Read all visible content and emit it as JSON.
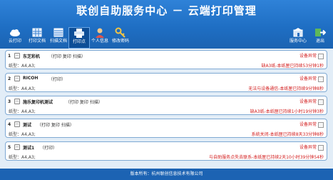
{
  "header": {
    "title": "联创自助服务中心 － 云端打印管理"
  },
  "toolbar": {
    "left": [
      {
        "label": "云打印"
      },
      {
        "label": "打印文档"
      },
      {
        "label": "扫描文档"
      },
      {
        "label": "打印点"
      },
      {
        "label": "个人信息"
      },
      {
        "label": "修改密码"
      }
    ],
    "right": [
      {
        "label": "服务中心"
      },
      {
        "label": "退出"
      }
    ]
  },
  "jobs": [
    {
      "num": "1",
      "expand": "－",
      "name": "东芝彩机",
      "caps": "（打印 复印 扫描）",
      "status": "设备异常",
      "model_label": "纸型：",
      "model": "A4,A3;",
      "message": "缺A3纸-本纸匣已持续53分钟1秒"
    },
    {
      "num": "2",
      "expand": "－",
      "name": "RICOH",
      "caps": "（打印）",
      "status": "设备异常",
      "model_label": "纸型：",
      "model": "A4,A3;",
      "message": "无法与设备通信-本纸匣已持续9分钟8秒"
    },
    {
      "num": "3",
      "expand": "－",
      "name": "施乐复印机测试",
      "caps": "（打印 复印 扫描）",
      "status": "设备异常",
      "model_label": "纸型：",
      "model": "A4,A3;",
      "message": "缺A3纸-本纸匣已持续1小时19分钟3秒"
    },
    {
      "num": "4",
      "expand": "－",
      "name": "测试",
      "caps": "（打印 复印 扫描）",
      "status": "设备异常",
      "model_label": "纸型：",
      "model": "A4,A3;",
      "message": "系统关闭-本纸匣已持续8天33分钟8秒"
    },
    {
      "num": "5",
      "expand": "－",
      "name": "测试1",
      "caps": "（打印）",
      "status": "设备异常",
      "model_label": "纸型：",
      "model": "A4,A3;",
      "message": "与自助服务点失去联系-本纸匣已持续2天10小时39分钟54秒"
    }
  ],
  "footer": {
    "text": "版本所有：杭州联创信息技术有限公司"
  },
  "colors": {
    "header": "#1f6fc4",
    "list_bg": "#e2edf7",
    "error": "#d32020"
  }
}
